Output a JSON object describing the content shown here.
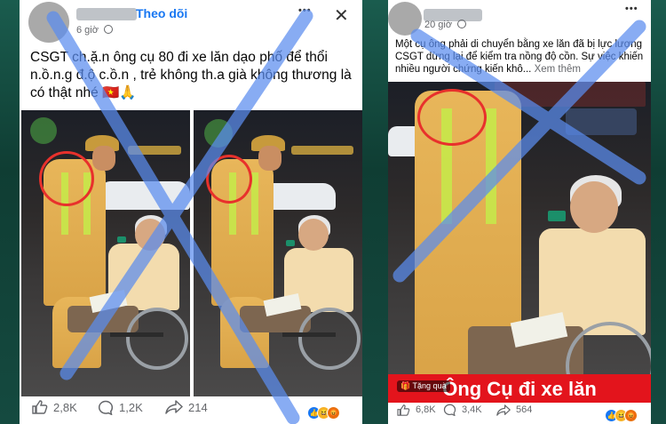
{
  "left_post": {
    "follow_label": "Theo dõi",
    "time": "6 giờ",
    "menu_glyph": "•••",
    "close_glyph": "✕",
    "text": "CSGT ch.ặ.n ông cụ 80 đi xe lăn dạo phố để thổi n.ồ.n.g đ.ộ c.ồ.n , trẻ không th.a già không thương là có thật nhé 🇻🇳🙏",
    "likes": "2,8K",
    "comments": "1,2K",
    "shares": "214"
  },
  "right_post": {
    "time": "20 giờ",
    "menu_glyph": "•••",
    "text": "Một cụ ông phải di chuyển bằng xe lăn đã bị lực lượng CSGT dừng lại để kiểm tra nồng độ cồn. Sự việc khiến nhiều người chứng kiến khô... ",
    "see_more": "Xem thêm",
    "gift_label": "Tặng quà",
    "banner": "Ông Cụ đi xe lăn",
    "likes": "6,8K",
    "comments": "3,4K",
    "shares": "564"
  },
  "icons": {
    "like": "like-icon",
    "comment": "comment-icon",
    "share": "share-icon",
    "globe": "globe-icon"
  },
  "colors": {
    "facebook_blue": "#1877f2",
    "annotation_red": "#e8312c",
    "cross_blue": "#5b8def",
    "banner_red": "#e3141c"
  }
}
